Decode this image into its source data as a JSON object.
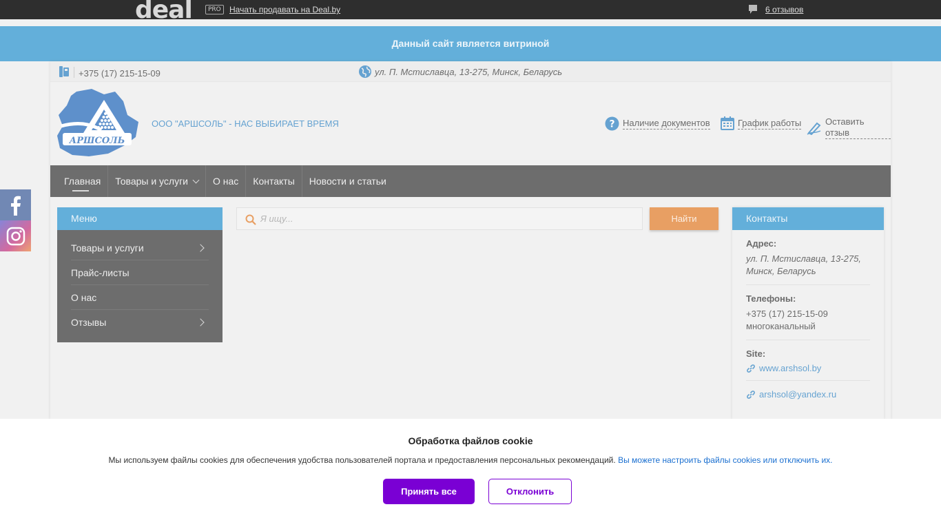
{
  "topbar": {
    "logo_text": "deal",
    "pro_badge": "PRO",
    "sell_link": "Начать продавать на Deal.by",
    "reviews_link": "6 отзывов",
    "reviews_icon": "comment-icon"
  },
  "banner": {
    "text": "Данный сайт является витриной"
  },
  "contactbar": {
    "phone": "+375 (17) 215-15-09",
    "address": "ул. П. Мстиславца, 13-275, Минск, Беларусь"
  },
  "header": {
    "logo_text": "АРШСОЛЬ",
    "tagline": "ООО \"АРШСОЛЬ\" - НАС ВЫБИРАЕТ ВРЕМЯ",
    "links": {
      "docs": "Наличие документов",
      "schedule": "График работы",
      "review": "Оставить отзыв"
    }
  },
  "nav": {
    "items": [
      "Главная",
      "Товары и услуги",
      "О нас",
      "Контакты",
      "Новости и статьи"
    ]
  },
  "menu": {
    "title": "Меню",
    "items": [
      "Товары и услуги",
      "Прайс-листы",
      "О нас",
      "Отзывы"
    ]
  },
  "search": {
    "placeholder": "Я ищу...",
    "button": "Найти"
  },
  "contacts": {
    "title": "Контакты",
    "address_label": "Адрес:",
    "address_value": "ул. П. Мстиславца, 13-275, Минск, Беларусь",
    "phones_label": "Телефоны:",
    "phone_value": "+375 (17) 215-15-09",
    "phone_note": "многоканальный",
    "site_label": "Site:",
    "site_value": "www.arshsol.by",
    "email_value": "arshsol@yandex.ru"
  },
  "cookie": {
    "title": "Обработка файлов cookie",
    "text": "Мы используем файлы cookies для обеспечения удобства пользователей портала и предоставления персональных рекомендаций.",
    "link": "Вы можете настроить файлы cookies или отключить их.",
    "accept": "Принять все",
    "decline": "Отклонить"
  },
  "colors": {
    "accent_blue": "#2891cc",
    "dark": "#353535",
    "orange": "#e07b28",
    "purple": "#7a00d4"
  }
}
